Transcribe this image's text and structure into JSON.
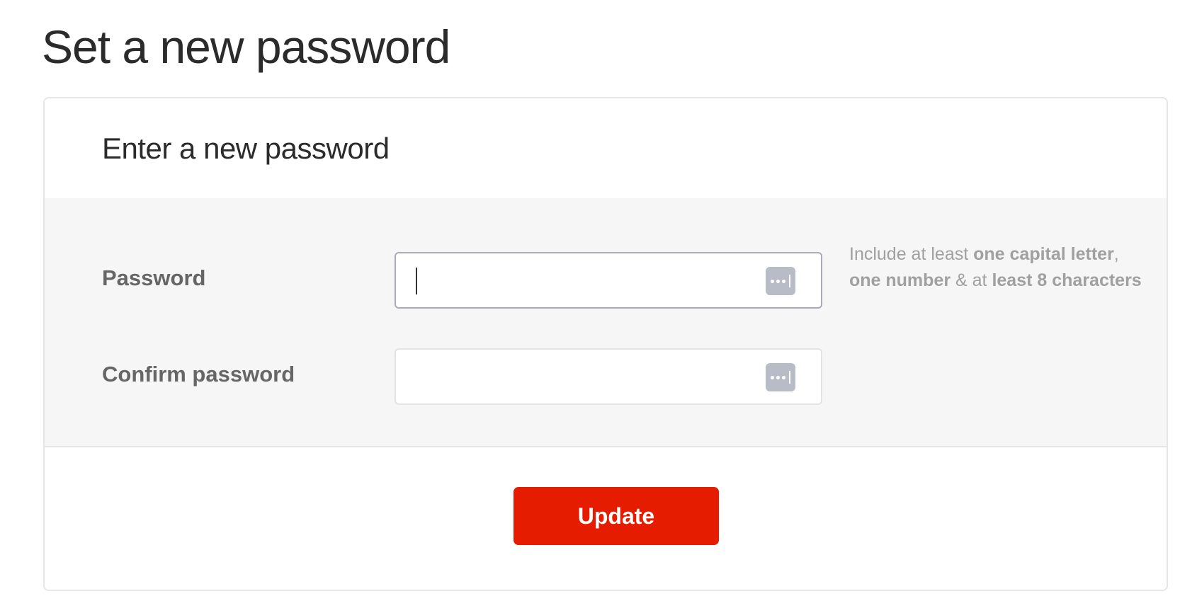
{
  "page": {
    "title": "Set a new password"
  },
  "card": {
    "header_title": "Enter a new password"
  },
  "form": {
    "password": {
      "label": "Password",
      "value": "",
      "placeholder": "",
      "icon": "password-manager-key-icon"
    },
    "confirm": {
      "label": "Confirm password",
      "value": "",
      "placeholder": "",
      "icon": "password-manager-key-icon"
    },
    "hint": {
      "part1": "Include at least ",
      "part2": "one capital letter",
      "part3": ", ",
      "part4": "one number",
      "part5": " & at ",
      "part6": "least 8 characters"
    }
  },
  "footer": {
    "update_label": "Update"
  },
  "colors": {
    "accent": "#e61c00",
    "panel_background": "#f6f6f6",
    "label_text": "#666666",
    "hint_text": "#a0a0a0"
  }
}
